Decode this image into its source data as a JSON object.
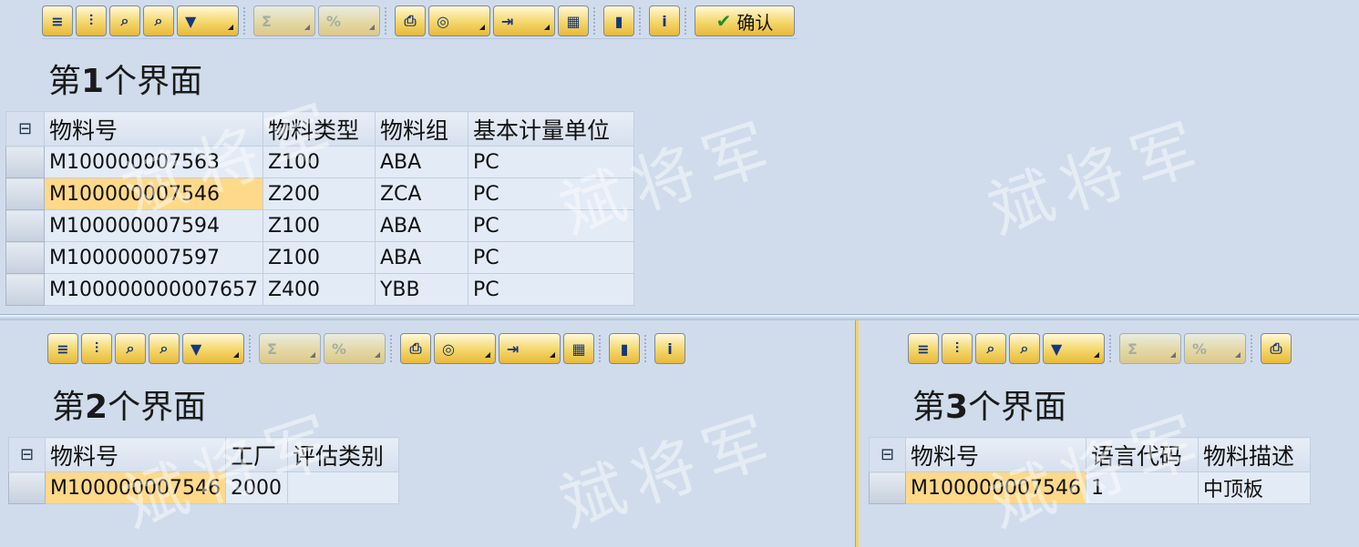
{
  "toolbar_icons": {
    "align": "≡",
    "filter": "⫶",
    "find": "⌕",
    "find_next": "⌕",
    "funnel": "▼",
    "sum": "Σ",
    "subtotal": "%",
    "print": "⎙",
    "views": "◎",
    "export": "⇥",
    "layout": "▦",
    "graphic": "▮",
    "info": "i",
    "check": "✔"
  },
  "screen1": {
    "title_prefix": "第",
    "title_num": "1",
    "title_suffix": "个界面",
    "confirm_label": "确认",
    "columns": [
      "物料号",
      "物料类型",
      "物料组",
      "基本计量单位"
    ],
    "rows": [
      [
        "M100000007563",
        "Z100",
        "ABA",
        "PC"
      ],
      [
        "M100000007546",
        "Z200",
        "ZCA",
        "PC"
      ],
      [
        "M100000007594",
        "Z100",
        "ABA",
        "PC"
      ],
      [
        "M100000007597",
        "Z100",
        "ABA",
        "PC"
      ],
      [
        "M100000000007657",
        "Z400",
        "YBB",
        "PC"
      ]
    ]
  },
  "screen2": {
    "title_prefix": "第",
    "title_num": "2",
    "title_suffix": "个界面",
    "columns": [
      "物料号",
      "工厂",
      "评估类别"
    ],
    "rows": [
      [
        "M100000007546",
        "2000",
        ""
      ]
    ]
  },
  "screen3": {
    "title_prefix": "第",
    "title_num": "3",
    "title_suffix": "个界面",
    "columns": [
      "物料号",
      "语言代码",
      "物料描述"
    ],
    "rows": [
      [
        "M100000007546",
        "1",
        "中顶板"
      ]
    ]
  },
  "watermark": "斌将军",
  "colors": {
    "background": "#d0dcec",
    "button": "#f4d66a",
    "highlight": "#ffd98a",
    "splitter": "#f4d26a"
  }
}
